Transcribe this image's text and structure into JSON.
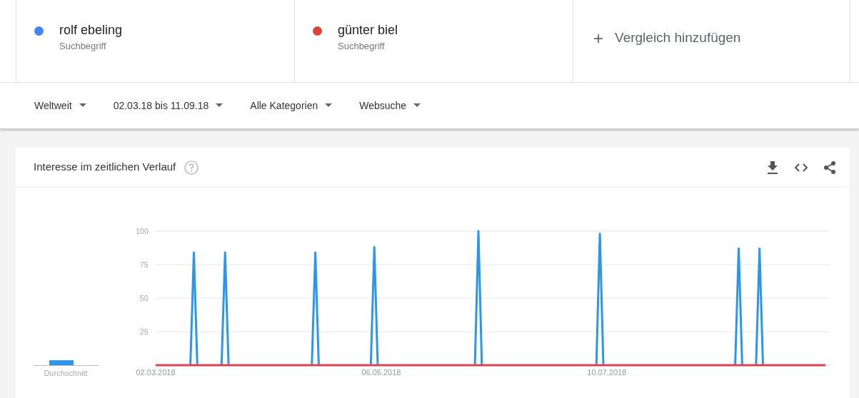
{
  "terms": [
    {
      "label": "rolf ebeling",
      "sublabel": "Suchbegriff",
      "color": "#4285f4"
    },
    {
      "label": "günter biel",
      "sublabel": "Suchbegriff",
      "color": "#db4437"
    }
  ],
  "add_comparison": {
    "icon": "+",
    "label": "Vergleich hinzufügen"
  },
  "filters": [
    {
      "label": "Weltweit"
    },
    {
      "label": "02.03.18 bis 11.09.18"
    },
    {
      "label": "Alle Kategorien"
    },
    {
      "label": "Websuche"
    }
  ],
  "chart_card": {
    "title": "Interesse im zeitlichen Verlauf",
    "average_label": "Durchschnitt",
    "chart_data": {
      "type": "line",
      "grid": true,
      "ylim": [
        0,
        100
      ],
      "yticks": [
        25,
        50,
        75,
        100
      ],
      "categories": [
        "02.03.2018",
        null,
        null,
        null,
        null,
        null,
        null,
        null,
        null,
        null,
        null,
        null,
        null,
        null,
        null,
        null,
        null,
        null,
        null,
        null,
        null,
        null,
        null,
        null,
        null,
        null,
        null,
        null,
        null,
        null,
        null,
        null,
        null,
        null,
        null,
        null,
        null,
        null,
        null,
        null,
        null,
        null,
        null,
        null,
        null,
        null,
        null,
        null,
        null,
        null,
        null,
        null,
        null,
        null,
        null,
        null,
        null,
        null,
        null,
        null,
        null,
        null,
        null,
        null,
        null,
        "06.05.2018",
        null,
        null,
        null,
        null,
        null,
        null,
        null,
        null,
        null,
        null,
        null,
        null,
        null,
        null,
        null,
        null,
        null,
        null,
        null,
        null,
        null,
        null,
        null,
        null,
        null,
        null,
        null,
        null,
        null,
        null,
        null,
        null,
        null,
        null,
        null,
        null,
        null,
        null,
        null,
        null,
        null,
        null,
        null,
        null,
        null,
        null,
        null,
        null,
        null,
        null,
        null,
        null,
        null,
        null,
        null,
        null,
        null,
        null,
        null,
        null,
        null,
        null,
        null,
        null,
        "10.07.2018",
        null,
        null,
        null,
        null,
        null,
        null,
        null,
        null,
        null,
        null,
        null,
        null,
        null,
        null,
        null,
        null,
        null,
        null,
        null,
        null,
        null,
        null,
        null,
        null,
        null,
        null,
        null,
        null,
        null,
        null,
        null,
        null,
        null,
        null,
        null,
        null,
        null,
        null,
        null,
        null,
        null,
        null,
        null,
        null,
        null,
        null,
        null,
        null,
        null,
        null,
        null,
        null,
        null,
        null,
        null,
        null,
        null,
        null,
        null,
        null,
        null,
        null,
        null
      ],
      "series": [
        {
          "color": "#2b96ee",
          "values": [
            null,
            null,
            null,
            null,
            null,
            null,
            null,
            null,
            null,
            null,
            0,
            84,
            0,
            null,
            null,
            null,
            null,
            null,
            null,
            0,
            84,
            0,
            null,
            null,
            null,
            null,
            null,
            null,
            null,
            null,
            null,
            null,
            null,
            null,
            null,
            null,
            null,
            null,
            null,
            null,
            null,
            null,
            null,
            null,
            null,
            0,
            84,
            0,
            null,
            null,
            null,
            null,
            null,
            null,
            null,
            null,
            null,
            null,
            null,
            null,
            null,
            null,
            0,
            88,
            0,
            null,
            null,
            null,
            null,
            null,
            null,
            null,
            null,
            null,
            null,
            null,
            null,
            null,
            null,
            null,
            null,
            null,
            null,
            null,
            null,
            null,
            null,
            null,
            null,
            null,
            null,
            null,
            0,
            100,
            0,
            null,
            null,
            null,
            null,
            null,
            null,
            null,
            null,
            null,
            null,
            null,
            null,
            null,
            null,
            null,
            null,
            null,
            null,
            null,
            null,
            null,
            null,
            null,
            null,
            null,
            null,
            null,
            null,
            null,
            null,
            null,
            null,
            0,
            98,
            0,
            null,
            null,
            null,
            null,
            null,
            null,
            null,
            null,
            null,
            null,
            null,
            null,
            null,
            null,
            null,
            null,
            null,
            null,
            null,
            null,
            null,
            null,
            null,
            null,
            null,
            null,
            null,
            null,
            null,
            null,
            null,
            null,
            null,
            null,
            null,
            null,
            null,
            0,
            87,
            0,
            null,
            null,
            null,
            0,
            87,
            0,
            null,
            null,
            null,
            null,
            null,
            null,
            null,
            null,
            null,
            null,
            null,
            null,
            null,
            null,
            null,
            null,
            null,
            null
          ]
        },
        {
          "color": "#db4455",
          "values": [
            0,
            0,
            0,
            0,
            0,
            0,
            0,
            0,
            0,
            0,
            0,
            0,
            0,
            0,
            0,
            0,
            0,
            0,
            0,
            0,
            0,
            0,
            0,
            0,
            0,
            0,
            0,
            0,
            0,
            0,
            0,
            0,
            0,
            0,
            0,
            0,
            0,
            0,
            0,
            0,
            0,
            0,
            0,
            0,
            0,
            0,
            0,
            0,
            0,
            0,
            0,
            0,
            0,
            0,
            0,
            0,
            0,
            0,
            0,
            0,
            0,
            0,
            0,
            0,
            0,
            0,
            0,
            0,
            0,
            0,
            0,
            0,
            0,
            0,
            0,
            0,
            0,
            0,
            0,
            0,
            0,
            0,
            0,
            0,
            0,
            0,
            0,
            0,
            0,
            0,
            0,
            0,
            0,
            0,
            0,
            0,
            0,
            0,
            0,
            0,
            0,
            0,
            0,
            0,
            0,
            0,
            0,
            0,
            0,
            0,
            0,
            0,
            0,
            0,
            0,
            0,
            0,
            0,
            0,
            0,
            0,
            0,
            0,
            0,
            0,
            0,
            0,
            0,
            0,
            0,
            0,
            0,
            0,
            0,
            0,
            0,
            0,
            0,
            0,
            0,
            0,
            0,
            0,
            0,
            0,
            0,
            0,
            0,
            0,
            0,
            0,
            0,
            0,
            0,
            0,
            0,
            0,
            0,
            0,
            0,
            0,
            0,
            0,
            0,
            0,
            0,
            0,
            0,
            0,
            0,
            0,
            0,
            0,
            0,
            0,
            0,
            0,
            0,
            0,
            0,
            0,
            0,
            0,
            0,
            0,
            0,
            0,
            0,
            0,
            0,
            0,
            0,
            0,
            0
          ]
        }
      ]
    }
  }
}
